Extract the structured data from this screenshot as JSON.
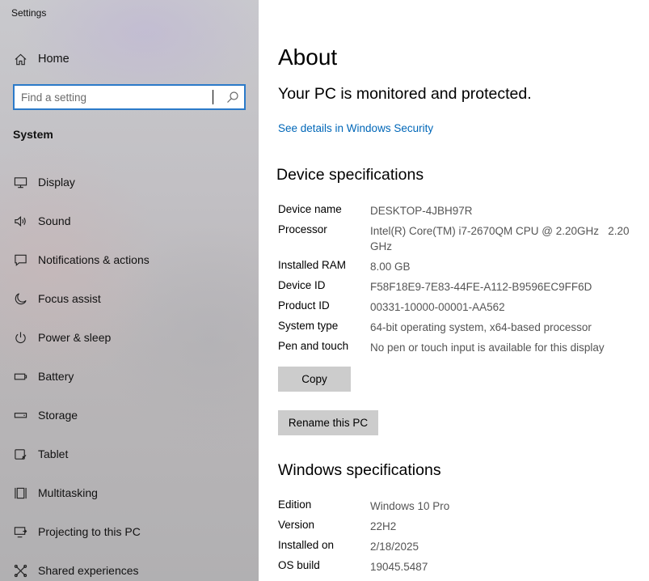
{
  "window": {
    "title": "Settings"
  },
  "sidebar": {
    "home_label": "Home",
    "search": {
      "placeholder": "Find a setting",
      "value": ""
    },
    "section_label": "System",
    "items": [
      {
        "label": "Display",
        "icon": "monitor-icon"
      },
      {
        "label": "Sound",
        "icon": "speaker-icon"
      },
      {
        "label": "Notifications & actions",
        "icon": "notification-icon"
      },
      {
        "label": "Focus assist",
        "icon": "moon-icon"
      },
      {
        "label": "Power & sleep",
        "icon": "power-icon"
      },
      {
        "label": "Battery",
        "icon": "battery-icon"
      },
      {
        "label": "Storage",
        "icon": "storage-icon"
      },
      {
        "label": "Tablet",
        "icon": "tablet-icon"
      },
      {
        "label": "Multitasking",
        "icon": "multitasking-icon"
      },
      {
        "label": "Projecting to this PC",
        "icon": "projecting-icon"
      },
      {
        "label": "Shared experiences",
        "icon": "shared-experiences-icon"
      }
    ]
  },
  "main": {
    "title": "About",
    "protection_status": "Your PC is monitored and protected.",
    "security_link": "See details in Windows Security",
    "device_specs": {
      "heading": "Device specifications",
      "rows": [
        {
          "key": "Device name",
          "value": "DESKTOP-4JBH97R"
        },
        {
          "key": "Processor",
          "value": "Intel(R) Core(TM) i7-2670QM CPU @ 2.20GHz   2.20 GHz"
        },
        {
          "key": "Installed RAM",
          "value": "8.00 GB"
        },
        {
          "key": "Device ID",
          "value": "F58F18E9-7E83-44FE-A112-B9596EC9FF6D"
        },
        {
          "key": "Product ID",
          "value": "00331-10000-00001-AA562"
        },
        {
          "key": "System type",
          "value": "64-bit operating system, x64-based processor"
        },
        {
          "key": "Pen and touch",
          "value": "No pen or touch input is available for this display"
        }
      ],
      "copy_label": "Copy",
      "rename_label": "Rename this PC"
    },
    "windows_specs": {
      "heading": "Windows specifications",
      "rows": [
        {
          "key": "Edition",
          "value": "Windows 10 Pro"
        },
        {
          "key": "Version",
          "value": "22H2"
        },
        {
          "key": "Installed on",
          "value": "2/18/2025"
        },
        {
          "key": "OS build",
          "value": "19045.5487"
        }
      ]
    }
  }
}
